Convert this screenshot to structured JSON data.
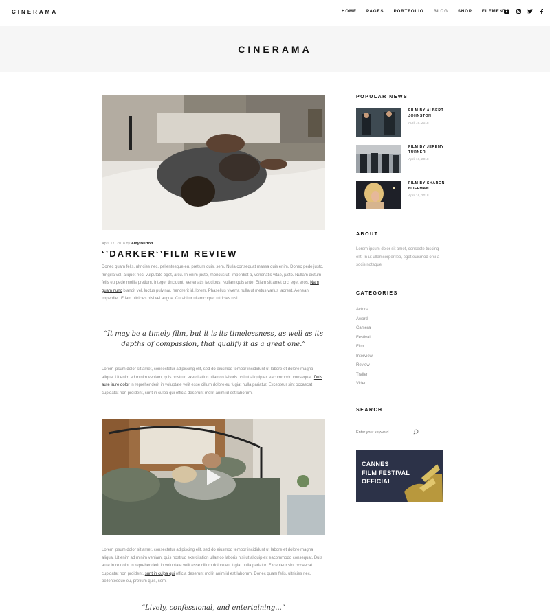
{
  "brand": {
    "logo": "CINERAMA"
  },
  "nav": {
    "items": [
      "HOME",
      "PAGES",
      "PORTFOLIO",
      "BLOG",
      "SHOP",
      "ELEMENTS"
    ],
    "active": "BLOG"
  },
  "social": {
    "icons": [
      "youtube-icon",
      "instagram-icon",
      "twitter-icon",
      "facebook-icon"
    ]
  },
  "band": {
    "title": "CINERAMA"
  },
  "post": {
    "date": "April 17, 2018",
    "by": "by",
    "author": "Amy Burton",
    "title": "‘’DARKER‘’FILM REVIEW",
    "p1_before": "Donec quam felis, ultricies nec, pellentesque eu, pretium quis, sem. Nulla consequat massa quis enim. Donec pede justo, fringilla vel, aliquet nec, vulputate eget, arcu. In enim justo, rhoncus ut, imperdiet a, venenatis vitae, justo. Nullam dictum felis eu pede mollis pretium. Integer tincidunt. Venenatis faucibus. Nullam quis ante. Etiam sit amet orci eget eros.",
    "p1_link": "Nam quam nunc",
    "p1_after": "blandit vel, luctus pulvinar, hendrerit id, lorem. Phasellus viverra nulla ut metus varius laoreet. Aenean imperdiet. Etiam ultricies nisi vel augue. Curabitur ullamcorper ultricies nisi.",
    "quote1": "“It may be a timely film, but it is its timelessness, as well as its depths of compassion, that qualify it as a great one.”",
    "p2_before": "Lorem ipsum dolor sit amet, consectetur adipiscing elit, sed do eiusmod tempor incididunt ut labore et dolore magna aliqua. Ut enim ad minim veniam, quis nostrud exercitation ullamco laboris nisi ut aliquip ex eacommodo consequat.",
    "p2_link": "Duis aute irure dolor",
    "p2_after": "in reprehenderit in voluptate velit esse cillum dolore eu fugiat nulla pariatur. Excepteur sint occaecat cupidatat non proident, sunt in culpa qui officia deserunt mollit anim id est laborum.",
    "p3_before": "Lorem ipsum dolor sit amet, consectetur adipiscing elit, sed do eiusmod tempor incididunt ut labore et dolore magna aliqua. Ut enim ad minim veniam, quis nostrud exercitation ullamco laboris nisi ut aliquip ex eacommodo consequat. Duis aute irure dolor in reprehenderit in voluptate velit esse cillum dolore eu fugiat nulla pariatur. Excepteur sint occaecat cupidatat non proident,",
    "p3_link": "sunt in culpa qui",
    "p3_after": "officia deserunt mollit anim id est laborum. Donec quam felis, ultricies nec, pellentesque eu, pretium quis, sem.",
    "quote2": "“Lively, confessional, and entertaining...”"
  },
  "sidebar": {
    "popular_title": "POPULAR NEWS",
    "popular": [
      {
        "title": "FILM BY ALBERT JOHNSTON",
        "date": "April 16, 2018"
      },
      {
        "title": "FILM BY JEREMY TURNER",
        "date": "April 16, 2018"
      },
      {
        "title": "FILM BY SHARON HOFFMAN",
        "date": "April 16, 2018"
      }
    ],
    "about_title": "ABOUT",
    "about_text": "Lorem ipsum dolor sit amet, consecte tuscing elit. In ut ullamcorper leo, eget euismod orci a socis notaque",
    "categories_title": "CATEGORIES",
    "categories": [
      "Actors",
      "Award",
      "Camera",
      "Festival",
      "Film",
      "Interview",
      "Review",
      "Trailer",
      "Video"
    ],
    "search_title": "SEARCH",
    "search_placeholder": "Enter your keyword...",
    "banner_lines": [
      "CANNES",
      "FILM FESTIVAL",
      "OFFICIAL"
    ]
  }
}
